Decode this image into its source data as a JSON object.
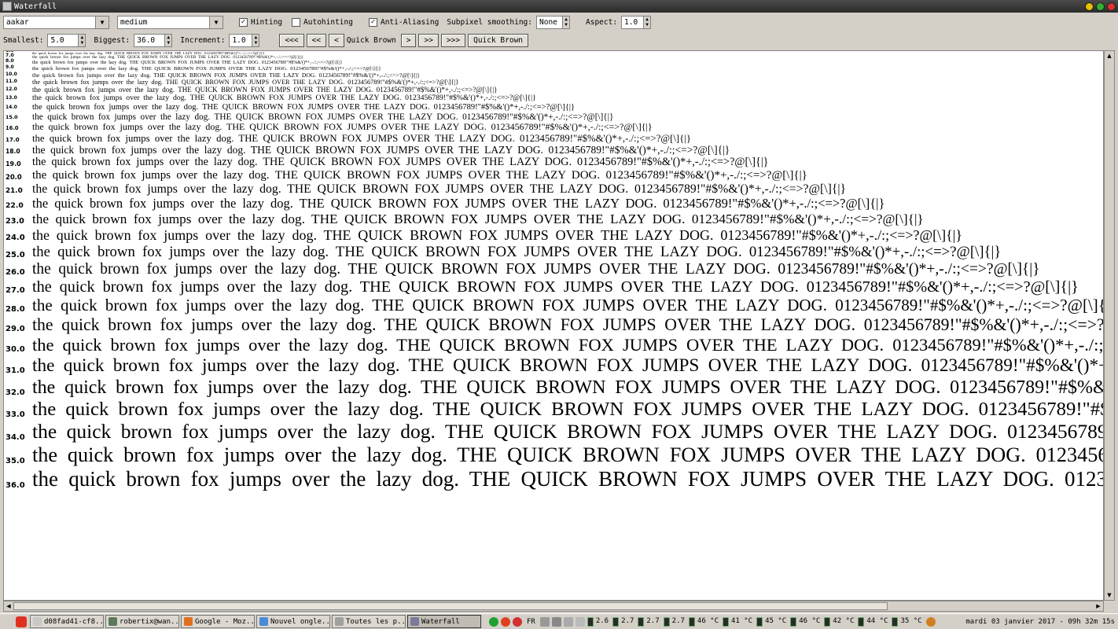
{
  "window": {
    "title": "Waterfall"
  },
  "toolbar": {
    "font_family": "aakar",
    "font_style": "medium",
    "hinting_label": "Hinting",
    "hinting_checked": true,
    "autohinting_label": "Autohinting",
    "autohinting_checked": false,
    "antialias_label": "Anti-Aliasing",
    "antialias_checked": true,
    "subpixel_label": "Subpixel smoothing:",
    "subpixel_value": "None",
    "aspect_label": "Aspect:",
    "aspect_value": "1.0",
    "smallest_label": "Smallest:",
    "smallest_value": "5.0",
    "biggest_label": "Biggest:",
    "biggest_value": "36.0",
    "increment_label": "Increment:",
    "increment_value": "1.0",
    "nav_first": "<<<",
    "nav_prev_fast": "<<",
    "nav_prev": "<",
    "sample_text": "Quick Brown",
    "nav_next": ">",
    "nav_next_fast": ">>",
    "nav_last": ">>>",
    "sample_button": "Quick Brown"
  },
  "waterfall": {
    "sample": "the quick brown fox jumps over the lazy dog. THE QUICK BROWN FOX JUMPS OVER THE LAZY DOG. 0123456789!\"#$%&'()*+,-./:;<=>?@[\\]{|}",
    "sizes": [
      "6.0",
      "7.0",
      "8.0",
      "9.0",
      "10.0",
      "11.0",
      "12.0",
      "13.0",
      "14.0",
      "15.0",
      "16.0",
      "17.0",
      "18.0",
      "19.0",
      "20.0",
      "21.0",
      "22.0",
      "23.0",
      "24.0",
      "25.0",
      "26.0",
      "27.0",
      "28.0",
      "29.0",
      "30.0",
      "31.0",
      "32.0",
      "33.0",
      "34.0",
      "35.0",
      "36.0"
    ]
  },
  "taskbar": {
    "tasks": [
      {
        "label": "d08fad41-cf8...",
        "color": "#c8c8c8"
      },
      {
        "label": "robertix@wan...",
        "color": "#5a7a5a"
      },
      {
        "label": "Google - Moz...",
        "color": "#e07020"
      },
      {
        "label": "Nouvel ongle...",
        "color": "#4a8ad8"
      },
      {
        "label": "Toutes les p...",
        "color": "#a0a0a0"
      },
      {
        "label": "Waterfall",
        "color": "#7a7a9a"
      }
    ],
    "lang": "FR",
    "readings": [
      "2.6",
      "2.7",
      "2.7",
      "2.7",
      "46 °C",
      "41 °C",
      "45 °C",
      "46 °C",
      "42 °C",
      "44 °C",
      "35 °C"
    ],
    "clock": "mardi 03 janvier 2017 - 09h 32m 15s"
  }
}
